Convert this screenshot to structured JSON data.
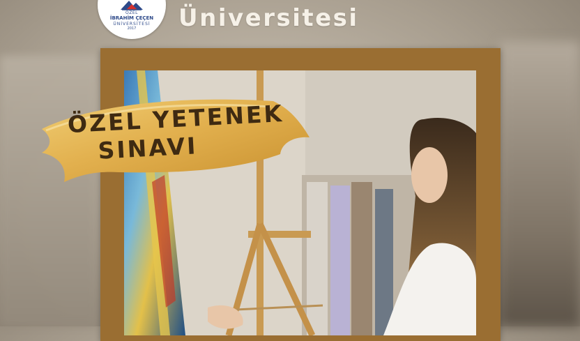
{
  "logo": {
    "line_top": "ÖZEL",
    "line_name": "İBRAHİM ÇEÇEN",
    "line_univ": "ÜNİVERSİTESİ",
    "line_year": "2017"
  },
  "header": {
    "title": "Üniversitesi"
  },
  "banner": {
    "line1": "ÖZEL YETENEK",
    "line2": "SINAVI"
  },
  "colors": {
    "frame": "#9a6e32",
    "banner_gold": "#e2b04e",
    "banner_text": "#3e2a12",
    "header_text": "#f6f1e8",
    "logo_blue": "#2e4a8a",
    "logo_red": "#d4312e"
  }
}
